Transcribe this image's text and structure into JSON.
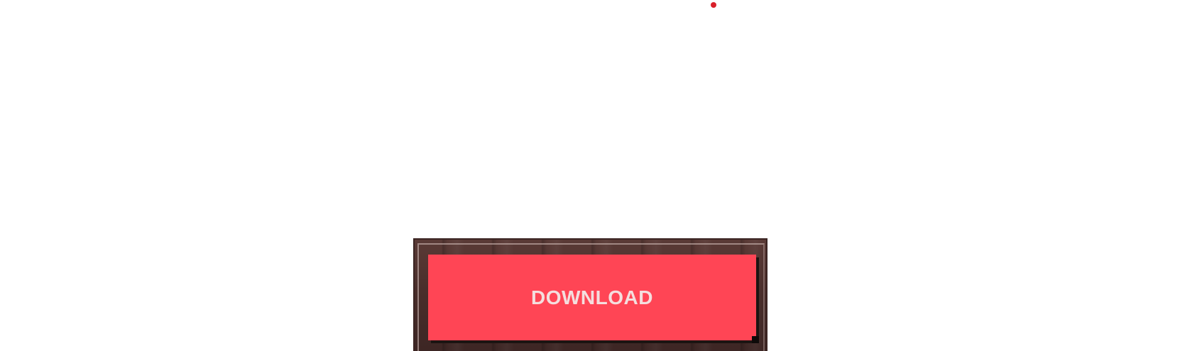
{
  "colors": {
    "page_background": "#ffffff",
    "indicator_dot": "#d9202a",
    "button_fill": "#ff4555",
    "frame_dark": "#4a2e2b"
  },
  "indicator": {
    "icon": "red-dot-indicator"
  },
  "download": {
    "label": "DOWNLOAD"
  }
}
